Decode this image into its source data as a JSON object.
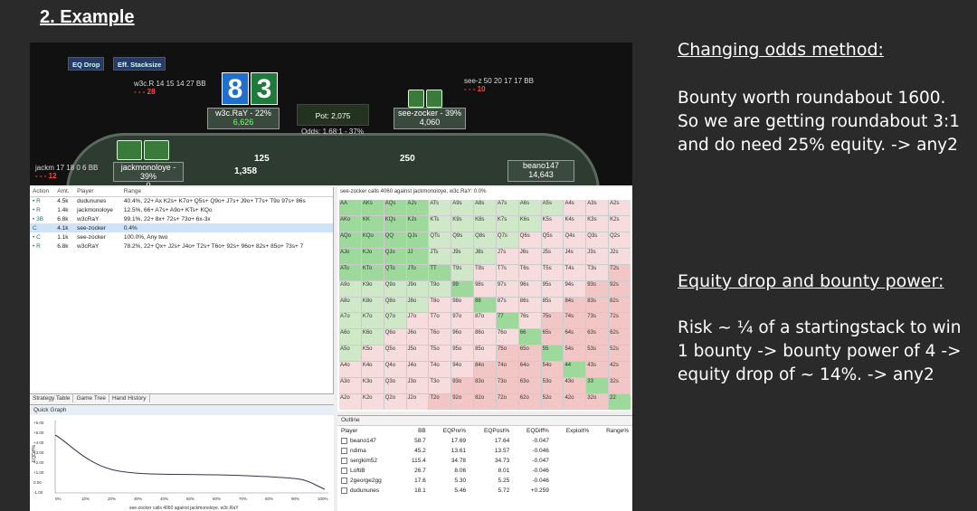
{
  "slide": {
    "title": "2. Example"
  },
  "notes": {
    "h1": "Changing odds method:",
    "p1": "Bounty worth roundabout 1600. So we are getting roundabout 3:1 and do need 25% equity. -> any2",
    "h2": "Equity drop and bounty power:",
    "p2": "Risk ~ ¼ of a startingstack to win 1 bounty -> bounty power of 4 -> equity drop of ~ 14%. -> any2"
  },
  "table": {
    "btn_eq": "EQ Drop",
    "btn_stack": "Eff. Stacksize",
    "hud_left": "w3c.R 14 15 14 27 BB",
    "hud_left_sub": "- - - 28",
    "big_left": "8",
    "big_right": "3",
    "hero_name": "w3c.RaY - 22%",
    "hero_stack": "6,626",
    "pot": "Pot: 2,075",
    "odds": "Odds: 1.68:1 - 37%",
    "vill_name": "see-zocker - 39%",
    "vill_stack": "4,060",
    "hud_right": "see-z 50 20 17 17 BB",
    "hud_right_sub": "- - - 10",
    "jack_hud": "jackm 17 18 0 6 BB",
    "jack_hud_sub": "- - - 12",
    "jack_name": "jackmonoloye - 39%",
    "jack_stack": "0",
    "chip_125": "125",
    "chip_1358": "1,358",
    "chip_250": "250",
    "beano_name": "beano147",
    "beano_stack": "14,643"
  },
  "actions": {
    "headers": [
      "Action",
      "Amt.",
      "Player",
      "Range"
    ],
    "rows": [
      {
        "a": "• R",
        "amt": "4.5k",
        "p": "dudununes",
        "r": "40.4%, 22+ Ax K2s+ K7o+ Q5s+ Q9o+ J7s+ J9o+ T7s+ T9o 97s+ 86s"
      },
      {
        "a": "• R",
        "amt": "1.4k",
        "p": "jackmonoloye",
        "r": "12.5%, 66+ A7s+ A9o+ KTs+ KQo"
      },
      {
        "a": "• 3B",
        "amt": "6.8k",
        "p": "w3cRaY",
        "r": "99.1%, 22+ 8x+ 72s+ 73o+ 6x-3x"
      },
      {
        "a": "C",
        "amt": "4.1k",
        "p": "see-zocker",
        "r": "0.4%"
      },
      {
        "a": "• C",
        "amt": "1.1k",
        "p": "see-zocker",
        "r": "100.0%, Any two"
      },
      {
        "a": "• R",
        "amt": "6.8k",
        "p": "w3cRaY",
        "r": "78.2%, 22+ Qx+ J2s+ J4o+ T2s+ T6o+ 92s+ 96o+ 82s+ 85o+ 73s+ 7"
      }
    ]
  },
  "tabs": [
    "Strategy Table",
    "Game Tree",
    "Hand History"
  ],
  "quick_graph": "Quick Graph",
  "graph": {
    "xlabel": "see-zocker calls 4060 against jackmonoloye, w3c.RaY",
    "ylabel": "EQDiff%",
    "yticks": [
      "+6.00",
      "+5.00",
      "+4.00",
      "+3.00",
      "+2.00",
      "+1.00",
      "0.00",
      "-1.00"
    ],
    "xticks": [
      "0%",
      "10%",
      "20%",
      "30%",
      "40%",
      "50%",
      "60%",
      "70%",
      "80%",
      "90%",
      "100%"
    ]
  },
  "matrix": {
    "header": "see-zocker calls 4060 against jackmonoloye, w3c.RaY: 0.0%",
    "ranks": [
      "A",
      "K",
      "Q",
      "J",
      "T",
      "9",
      "8",
      "7",
      "6",
      "5",
      "4",
      "3",
      "2"
    ]
  },
  "outline": {
    "title": "Outline",
    "headers": [
      "Player",
      "BB",
      "EQPre%",
      "EQPost%",
      "EQDiff%",
      "Exploit%",
      "Range%"
    ],
    "rows": [
      [
        "beano147",
        "58.7",
        "17.69",
        "17.64",
        "-0.047"
      ],
      [
        "ndima",
        "45.2",
        "13.61",
        "13.57",
        "-0.046"
      ],
      [
        "sergkim52",
        "115.4",
        "34.78",
        "34.73",
        "-0.047"
      ],
      [
        "LoftiB",
        "26.7",
        "8.06",
        "8.01",
        "-0.046"
      ],
      [
        "2george2gg",
        "17.6",
        "5.30",
        "5.25",
        "-0.046"
      ],
      [
        "dudununes",
        "18.1",
        "5.46",
        "5.72",
        "+0.259"
      ]
    ]
  }
}
